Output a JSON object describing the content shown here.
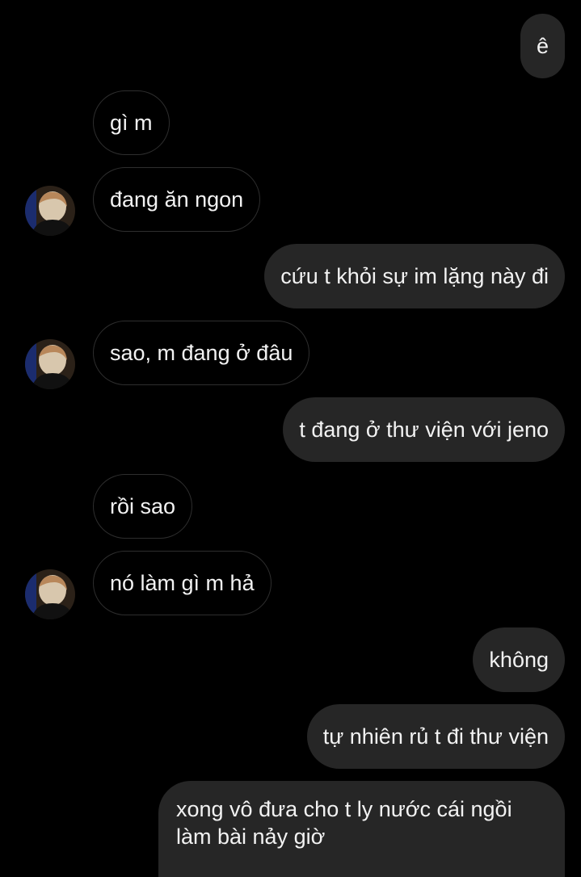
{
  "messages": [
    {
      "side": "out",
      "text": "ê"
    },
    {
      "side": "in",
      "text": "gì m"
    },
    {
      "side": "in",
      "text": "đang ăn ngon"
    },
    {
      "side": "out",
      "text": "cứu t khỏi sự im lặng này đi"
    },
    {
      "side": "in",
      "text": "sao, m đang ở đâu"
    },
    {
      "side": "out",
      "text": "t đang ở thư viện với jeno"
    },
    {
      "side": "in",
      "text": "rồi sao"
    },
    {
      "side": "in",
      "text": "nó làm gì m hả"
    },
    {
      "side": "out",
      "text": "không"
    },
    {
      "side": "out",
      "text": "tự nhiên rủ t đi thư viện"
    },
    {
      "side": "out",
      "lines": [
        "xong vô đưa cho t ly nước cái ngồi",
        "làm bài nảy giờ"
      ]
    }
  ],
  "colors": {
    "background": "#000000",
    "outgoing_bubble": "#262626",
    "incoming_border": "#2e2e2e",
    "text": "#f2f2f2"
  },
  "icons": {
    "avatar": "contact-avatar-photo"
  }
}
